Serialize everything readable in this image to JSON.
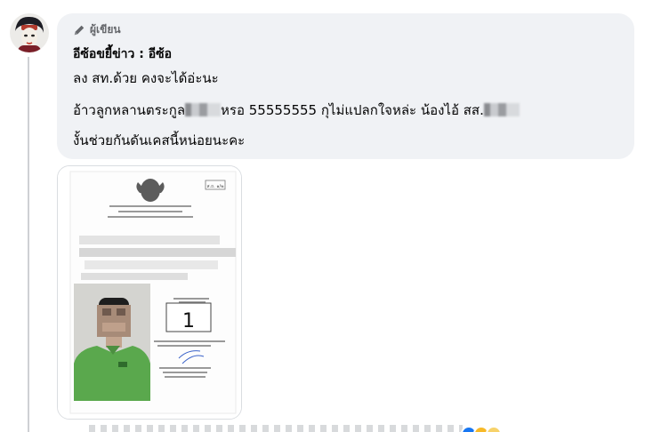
{
  "comment": {
    "author_badge": "ผู้เขียน",
    "author_name": "อีซ้อขยี้ข่าว : อีซ้อ",
    "lines": {
      "line1": "ลง สท.ด้วย คงจะได้อ่ะนะ",
      "line2_a": "อ้าวลูกหลานตระกูล",
      "line2_b": "หรอ 55555555 กุไม่แปลกใจหล่ะ น้องไอ้ สส.",
      "line3": "งั้นช่วยกันดันเคสนี้หน่อยนะคะ"
    }
  },
  "attachment": {
    "top_right_tag": "ส.ถ. ๑/๒",
    "candidate_number": "1"
  },
  "icons": {
    "badge": "pencil-icon",
    "avatar": "user-avatar-icon"
  },
  "colors": {
    "bubble_bg": "#f0f2f5",
    "meta_text": "#65676b",
    "thread_line": "#ced0d4",
    "shirt_green": "#5aa84d"
  }
}
